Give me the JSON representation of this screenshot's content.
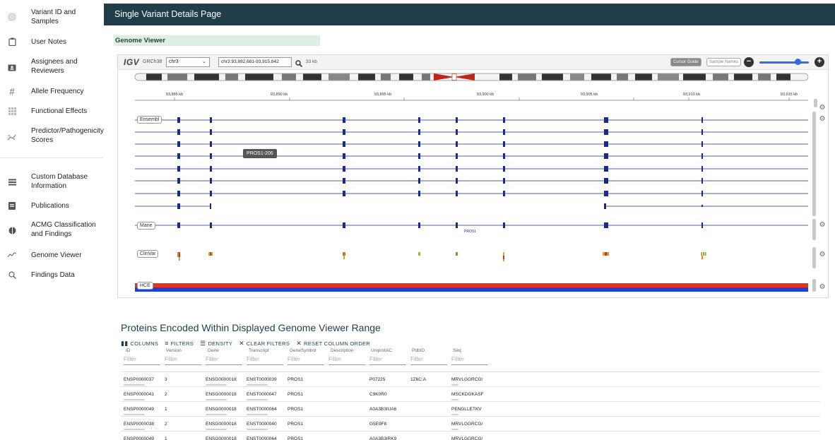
{
  "header": {
    "title": "Single Variant Details Page"
  },
  "sidebar": {
    "items": [
      {
        "label": "Variant ID and Samples",
        "icon": "fingerprint-icon"
      },
      {
        "label": "User Notes",
        "icon": "clipboard-icon"
      },
      {
        "label": "Assignees and Reviewers",
        "icon": "person-card-icon"
      },
      {
        "label": "Allele Frequency",
        "icon": "hash-icon"
      },
      {
        "label": "Functional Effects",
        "icon": "grid-icon"
      },
      {
        "label": "Predictor/Pathogenicity Scores",
        "icon": "scatter-icon"
      },
      {
        "label": "Custom Database Information",
        "icon": "list-icon"
      },
      {
        "label": "Publications",
        "icon": "document-icon"
      },
      {
        "label": "ACMG Classification and Findings",
        "icon": "drop-icon"
      },
      {
        "label": "Genome Viewer",
        "icon": "line-chart-icon"
      },
      {
        "label": "Findings Data",
        "icon": "search-icon"
      }
    ]
  },
  "genome_viewer": {
    "section_title": "Genome Viewer",
    "logo": "IGV",
    "genome": "GRCh38",
    "chromosome": "chr3",
    "locus": "chr3:93,882,681-93,915,842",
    "width_label": "33 kb",
    "cursor_guide_label": "Cursor Guide",
    "sample_names_label": "Sample Names",
    "zoom_minus": "−",
    "zoom_plus": "+",
    "zoom_level_fraction": 0.72,
    "ruler_ticks": [
      "93,885 kb",
      "93,890 kb",
      "93,895 kb",
      "93,900 kb",
      "93,905 kb",
      "93,910 kb",
      "93,915 kb"
    ],
    "tracks": {
      "ensembl_label": "Ensembl",
      "mane_label": "Mane",
      "mane_gene": "PROS1",
      "clinvar_label": "ClinVar",
      "hce_label": "HCE"
    },
    "tooltip": "PROS1-206",
    "colors": {
      "transcript": "#1a2a8c",
      "hce_top": "#e8331c",
      "hce_bottom": "#1d3fe0",
      "ideogram_centromere": "#c0251b"
    }
  },
  "proteins": {
    "title": "Proteins Encoded Within Displayed Genome Viewer Range",
    "toolbar": {
      "columns": "COLUMNS",
      "filters": "FILTERS",
      "density": "DENSITY",
      "clear_filters": "CLEAR FILTERS",
      "reset_order": "RESET COLUMN ORDER"
    },
    "filter_placeholder": "Filter",
    "columns": [
      "ID",
      "Version",
      "Gene",
      "Transcript",
      "GeneSymbol",
      "Description",
      "UniprotAC",
      "PdbID",
      "Seq"
    ],
    "rows": [
      [
        "ENSP0000037",
        "3",
        "ENSG0000018",
        "ENST0000039",
        "PROS1",
        "",
        "P07225",
        "1Z6C:A",
        "MRVLGGRCG/"
      ],
      [
        "ENSP0000041",
        "2",
        "ENSG0000018",
        "ENST0000047",
        "PROS1",
        "",
        "C9K0R0",
        "",
        "MSCKDGKASF"
      ],
      [
        "ENSP0000049",
        "1",
        "ENSG0000018",
        "ENST0000064",
        "PROS1",
        "",
        "A0A3B3IUA6",
        "",
        "PENGLLETKV"
      ],
      [
        "ENSP0000038",
        "2",
        "ENSG0000018",
        "ENST0000040",
        "PROS1",
        "",
        "G5E9F8",
        "",
        "MRVLGGRCG/"
      ],
      [
        "ENSP0000049",
        "1",
        "ENSG0000018",
        "ENST0000064",
        "PROS1",
        "",
        "A0A3B3IRK9",
        "",
        "MRVLGGRCG/"
      ]
    ]
  }
}
